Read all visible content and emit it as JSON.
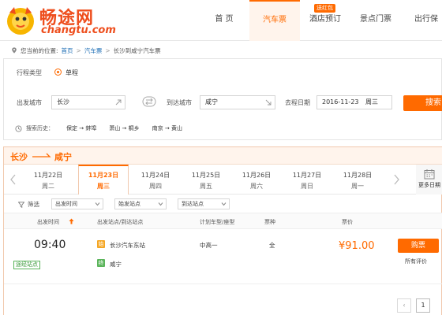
{
  "header": {
    "logo_cn": "畅途网",
    "logo_en": "changtu.com",
    "nav": [
      {
        "label": "首  页",
        "active": false
      },
      {
        "label": "汽车票",
        "active": true
      },
      {
        "label": "酒店预订",
        "active": false,
        "badge": "送红包"
      },
      {
        "label": "景点门票",
        "active": false
      },
      {
        "label": "出行保",
        "active": false
      }
    ]
  },
  "breadcrumb": {
    "prefix": "您当前的位置:",
    "items": [
      "首页",
      "汽车票",
      "长沙到咸宁汽车票"
    ]
  },
  "search": {
    "trip_type_label": "行程类型",
    "trip_type_value": "单程",
    "from_label": "出发城市",
    "from_value": "长沙",
    "to_label": "到达城市",
    "to_value": "咸宁",
    "date_label": "去程日期",
    "date_value": "2016-11-23",
    "weekday_value": "周三",
    "button": "搜索",
    "history_label": "搜索历史：",
    "history": [
      "保定 → 蚌埠",
      "萧山 → 桐乡",
      "南京 → 黄山"
    ]
  },
  "route": {
    "from": "长沙",
    "to": "咸宁"
  },
  "dates": [
    {
      "date": "11月22日",
      "weekday": "周二",
      "active": false
    },
    {
      "date": "11月23日",
      "weekday": "周三",
      "active": true
    },
    {
      "date": "11月24日",
      "weekday": "周四",
      "active": false
    },
    {
      "date": "11月25日",
      "weekday": "周五",
      "active": false
    },
    {
      "date": "11月26日",
      "weekday": "周六",
      "active": false
    },
    {
      "date": "11月27日",
      "weekday": "周日",
      "active": false
    },
    {
      "date": "11月28日",
      "weekday": "周一",
      "active": false
    }
  ],
  "more_dates_label": "更多日期",
  "filters": {
    "label": "筛选",
    "selects": [
      "出发时间",
      "始发站点",
      "到达站点"
    ]
  },
  "columns": [
    "出发时间",
    "出发站点/到达站点",
    "计划车型/座型",
    "票种",
    "票价"
  ],
  "results": [
    {
      "time": "09:40",
      "tag": "途经站点",
      "from_badge": "始",
      "from_station": "长沙汽车东站",
      "to_badge": "终",
      "to_station": "咸宁",
      "bus_type": "中高一",
      "ticket_type": "全",
      "price": "¥91.00",
      "buy_label": "购票",
      "reviews_label": "所有评价"
    }
  ],
  "pagination": {
    "prev": "‹",
    "current": "1"
  },
  "colors": {
    "accent": "#ff6a00",
    "link": "#1f6fb6",
    "green": "#5ab45a"
  }
}
